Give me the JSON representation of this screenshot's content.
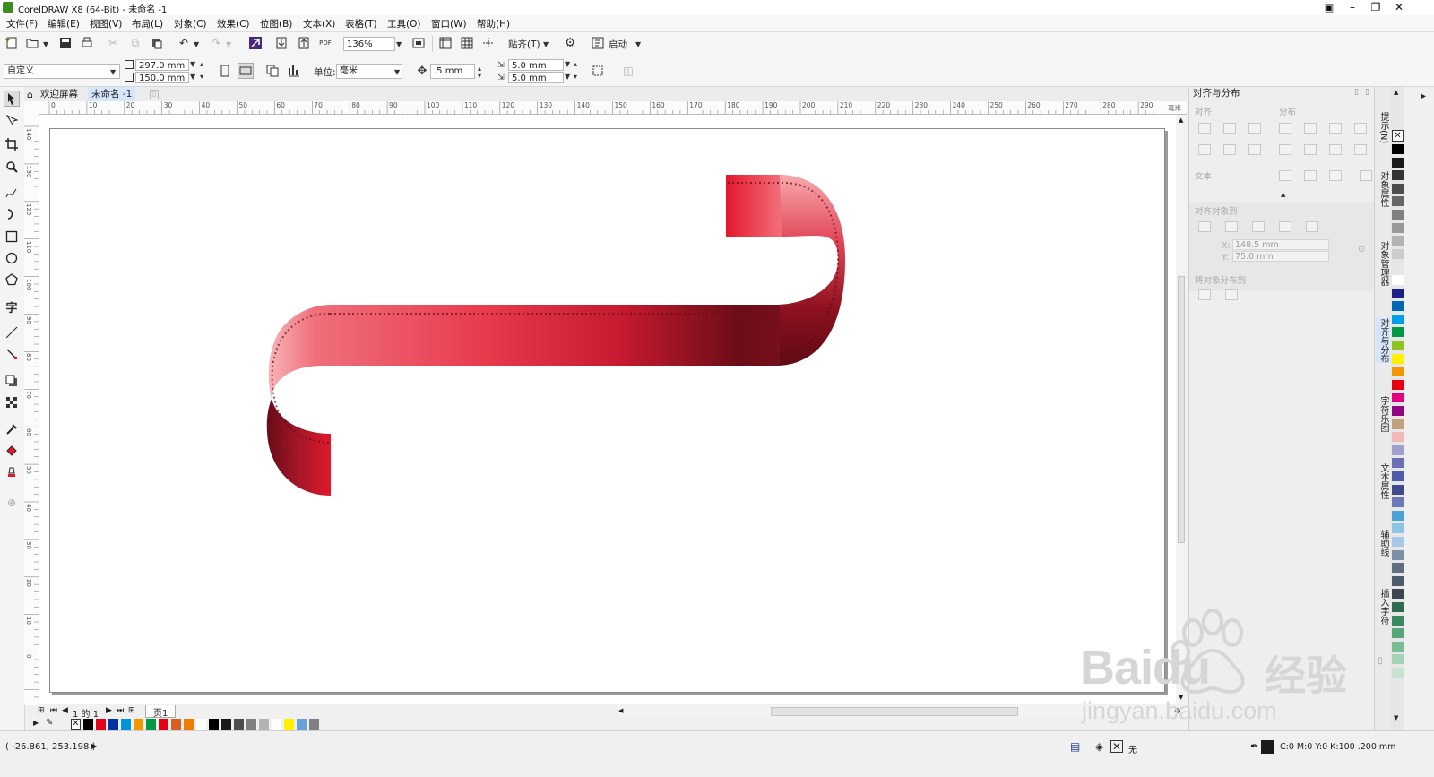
{
  "window": {
    "title": "CorelDRAW X8 (64-Bit) - 未命名 -1"
  },
  "menu": [
    "文件(F)",
    "编辑(E)",
    "视图(V)",
    "布局(L)",
    "对象(C)",
    "效果(C)",
    "位图(B)",
    "文本(X)",
    "表格(T)",
    "工具(O)",
    "窗口(W)",
    "帮助(H)"
  ],
  "standard_toolbar": {
    "zoom": "136%",
    "snap": "贴齐(T)",
    "launch": "启动"
  },
  "property_bar": {
    "preset": "自定义",
    "width": "297.0 mm",
    "height": "150.0 mm",
    "units_label": "单位:",
    "units": "毫米",
    "nudge": ".5 mm",
    "dup_x": "5.0 mm",
    "dup_y": "5.0 mm"
  },
  "tabs": [
    "欢迎屏幕",
    "未命名 -1"
  ],
  "ruler_h": [
    "0",
    "10",
    "20",
    "30",
    "40",
    "50",
    "60",
    "70",
    "80",
    "90",
    "100",
    "110",
    "120",
    "130",
    "140",
    "150",
    "160",
    "170",
    "180",
    "190",
    "200",
    "210",
    "220",
    "230",
    "240",
    "250",
    "260",
    "270",
    "280",
    "290"
  ],
  "ruler_h_unit": "毫米",
  "ruler_v": [
    "140",
    "130",
    "120",
    "110",
    "100",
    "90",
    "80",
    "70",
    "60",
    "50",
    "40",
    "30",
    "20",
    "10",
    "0"
  ],
  "page_nav": {
    "counter": "1 的 1",
    "page_tab": "页1"
  },
  "docker": {
    "title": "对齐与分布",
    "sections": {
      "align": "对齐",
      "distribute": "分布",
      "text": "文本",
      "align_to": "对齐对象到",
      "distribute_to": "将对象分布到"
    },
    "x_label": "X:",
    "x_value": "148.5 mm",
    "y_label": "Y:",
    "y_value": "75.0 mm"
  },
  "vertical_tabs": [
    "提示(N)",
    "对象属性",
    "对象管理器",
    "对齐与分布",
    "字符乐团",
    "文本属性",
    "辅助线",
    "插入字符"
  ],
  "status": {
    "coords": "( -26.861, 253.198 )",
    "fill": "无",
    "outline": "C:0 M:0 Y:0 K:100  .200 mm"
  },
  "watermark": {
    "brand": "Baidu",
    "brand_cn": "经验",
    "url": "jingyan.baidu.com"
  },
  "colors": {
    "ribbon_bright": "#e2182b",
    "ribbon_dark": "#6b0d18",
    "ribbon_light": "#f58a93",
    "watermark": "#d6d6d6"
  },
  "palette_bottom": [
    "#000000",
    "#e2001a",
    "#00339f",
    "#0094d8",
    "#f39800",
    "#009944",
    "#e60012",
    "#d95e21",
    "#ee7d00",
    "#ffffff",
    "#000000",
    "#1a1a1a",
    "#4d4d4d",
    "#808080",
    "#b3b3b3",
    "#ffffff",
    "#fff100",
    "#6aa0d8",
    "#7f7f7f"
  ],
  "palette_right": [
    "#000000",
    "#1a1a1a",
    "#333333",
    "#4d4d4d",
    "#666666",
    "#808080",
    "#999999",
    "#b3b3b3",
    "#cccccc",
    "#e6e6e6",
    "#ffffff",
    "#1d2088",
    "#0068b7",
    "#00a0e9",
    "#009944",
    "#8fc31f",
    "#fff100",
    "#f39800",
    "#e60012",
    "#e4007f",
    "#920783",
    "#c2a27d",
    "#f3b8b8",
    "#9fa0d0",
    "#6d6fb5",
    "#4f5ba8",
    "#3e4a8c",
    "#6c79b8",
    "#4aa2d8",
    "#8ec5e6",
    "#a7c8e8",
    "#7b8fa6",
    "#5f6f82",
    "#4d5a69",
    "#3b4652",
    "#2f6c4e",
    "#39885e",
    "#57a679",
    "#79bc95",
    "#a5d1b6",
    "#c8e3d1"
  ]
}
